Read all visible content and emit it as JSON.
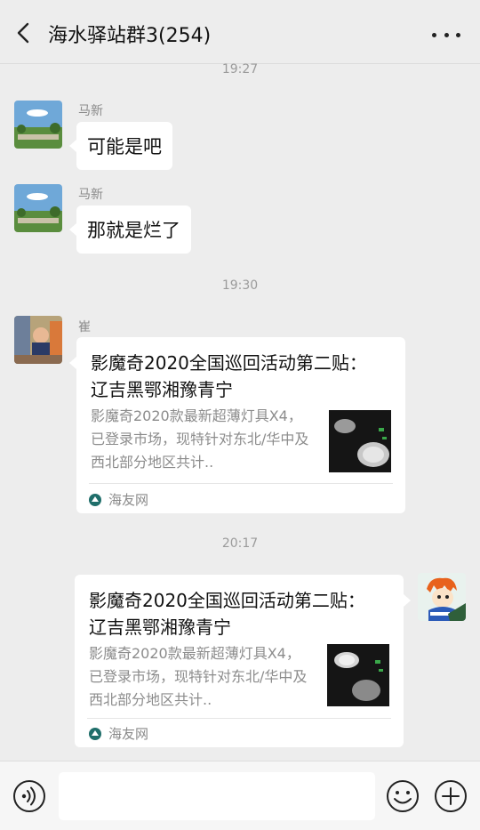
{
  "header": {
    "title": "海水驿站群3(254)"
  },
  "timestamps": [
    "19:27",
    "19:30",
    "20:17"
  ],
  "messages": [
    {
      "sender": "马新",
      "text": "可能是吧"
    },
    {
      "sender": "马新",
      "text": "那就是烂了"
    }
  ],
  "cards": [
    {
      "sender": "崔",
      "title": "影魔奇2020全国巡回活动第二贴： 辽吉黑鄂湘豫青宁",
      "desc": "影魔奇2020款最新超薄灯具X4，已登录市场，现特针对东北/华中及西北部分地区共计..",
      "source": "海友网"
    },
    {
      "title": "影魔奇2020全国巡回活动第二贴： 辽吉黑鄂湘豫青宁",
      "desc": "影魔奇2020款最新超薄灯具X4，已登录市场，现特针对东北/华中及西北部分地区共计..",
      "source": "海友网"
    }
  ],
  "icons": {
    "back": "back-chevron-icon",
    "more": "more-dots-icon",
    "voice": "voice-icon",
    "emoji": "emoji-icon",
    "plus": "plus-icon",
    "source": "source-logo-icon"
  },
  "colors": {
    "background": "#ededed",
    "bubble": "#ffffff",
    "muted": "#8a8a8a"
  }
}
